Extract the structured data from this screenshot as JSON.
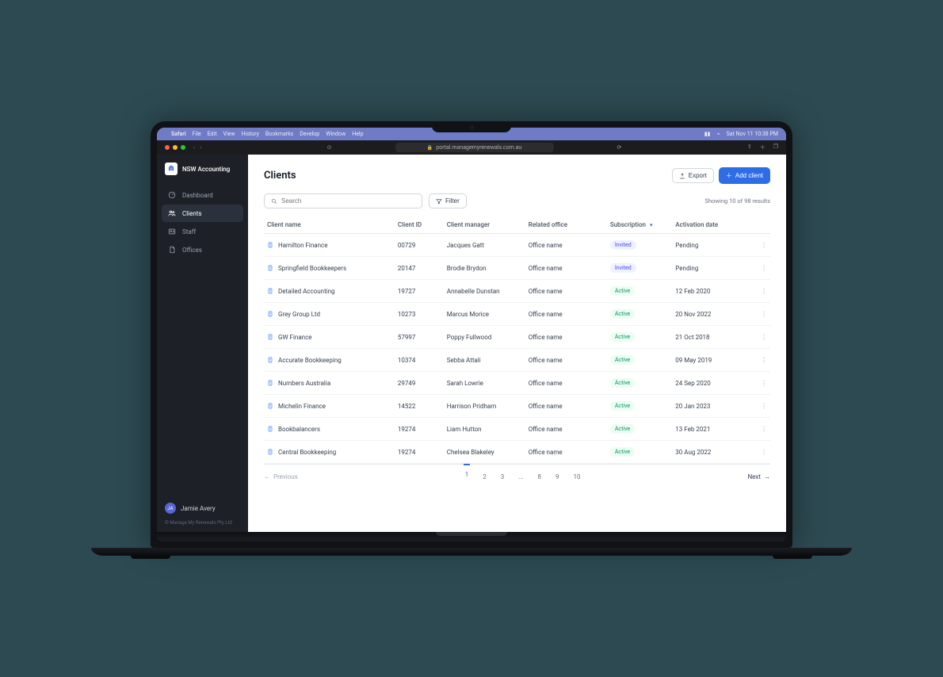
{
  "macMenu": {
    "app": "Safari",
    "items": [
      "File",
      "Edit",
      "View",
      "History",
      "Bookmarks",
      "Develop",
      "Window",
      "Help"
    ],
    "datetime": "Sat Nov 11 10:38 PM"
  },
  "browser": {
    "url": "portal.managemyrenewals.com.au"
  },
  "sidebar": {
    "orgName": "NSW Accounting",
    "items": [
      {
        "key": "dashboard",
        "label": "Dashboard",
        "icon": "gauge"
      },
      {
        "key": "clients",
        "label": "Clients",
        "icon": "users",
        "active": true
      },
      {
        "key": "staff",
        "label": "Staff",
        "icon": "id"
      },
      {
        "key": "offices",
        "label": "Offices",
        "icon": "doc"
      }
    ],
    "user": {
      "initials": "JA",
      "name": "Jamie Avery"
    },
    "copyright": "© Manage My Renewals Pty Ltd"
  },
  "page": {
    "title": "Clients",
    "exportLabel": "Export",
    "addLabel": "Add client",
    "searchPlaceholder": "Search",
    "filterLabel": "Filter",
    "resultsText": "Showing 10 of 98 results"
  },
  "table": {
    "columns": [
      "Client name",
      "Client ID",
      "Client manager",
      "Related office",
      "Subscription",
      "Activation date"
    ],
    "rows": [
      {
        "name": "Hamilton Finance",
        "id": "00729",
        "manager": "Jacques Gatt",
        "office": "Office name",
        "subscription": "Invited",
        "activation": "Pending"
      },
      {
        "name": "Springfield Bookkeepers",
        "id": "20147",
        "manager": "Brodie Brydon",
        "office": "Office name",
        "subscription": "Invited",
        "activation": "Pending"
      },
      {
        "name": "Detailed Accounting",
        "id": "19727",
        "manager": "Annabelle Dunstan",
        "office": "Office name",
        "subscription": "Active",
        "activation": "12 Feb 2020"
      },
      {
        "name": "Grey Group Ltd",
        "id": "10273",
        "manager": "Marcus Morice",
        "office": "Office name",
        "subscription": "Active",
        "activation": "20 Nov 2022"
      },
      {
        "name": "GW Finance",
        "id": "57997",
        "manager": "Poppy Fullwood",
        "office": "Office name",
        "subscription": "Active",
        "activation": "21 Oct 2018"
      },
      {
        "name": "Accurate Bookkeeping",
        "id": "10374",
        "manager": "Sebba Attali",
        "office": "Office name",
        "subscription": "Active",
        "activation": "09 May 2019"
      },
      {
        "name": "Numbers Australia",
        "id": "29749",
        "manager": "Sarah Lowrie",
        "office": "Office name",
        "subscription": "Active",
        "activation": "24 Sep 2020"
      },
      {
        "name": "Michelin Finance",
        "id": "14522",
        "manager": "Harrison Pridham",
        "office": "Office name",
        "subscription": "Active",
        "activation": "20 Jan 2023"
      },
      {
        "name": "Bookbalancers",
        "id": "19274",
        "manager": "Liam Hutton",
        "office": "Office name",
        "subscription": "Active",
        "activation": "13 Feb 2021"
      },
      {
        "name": "Central Bookkeeping",
        "id": "19274",
        "manager": "Chelsea Blakeley",
        "office": "Office name",
        "subscription": "Active",
        "activation": "30 Aug 2022"
      }
    ]
  },
  "pagination": {
    "prev": "Previous",
    "next": "Next",
    "pages": [
      "1",
      "2",
      "3",
      "...",
      "8",
      "9",
      "10"
    ],
    "current": "1"
  }
}
